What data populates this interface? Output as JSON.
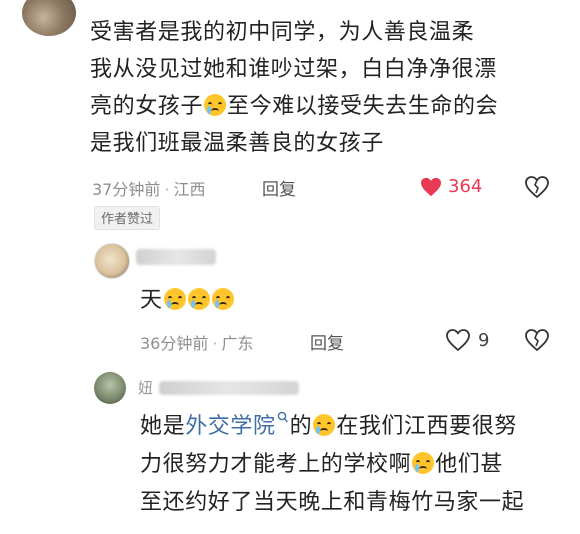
{
  "comment1": {
    "lines": [
      "受害者是我的初中同学，为人善良温柔",
      "我从没见过她和谁吵过架，白白净净很漂",
      "亮的女孩子",
      "至今难以接受失去生命的会",
      "是我们班最温柔善良的女孩子"
    ],
    "time": "37分钟前",
    "location": "江西",
    "reply_label": "回复",
    "likes": "364",
    "author_badge": "作者赞过"
  },
  "reply1": {
    "text": "天",
    "time": "36分钟前",
    "location": "广东",
    "reply_label": "回复",
    "likes": "9"
  },
  "comment2": {
    "name_prefix": "妞",
    "line1_a": "她是",
    "line1_link": "外交学院",
    "line1_b": "的",
    "line1_c": "在我们江西要很努",
    "line2_a": "力很努力才能考上的学校啊",
    "line2_b": "他们甚",
    "line3": "至还约好了当天晚上和青梅竹马家一起"
  },
  "colors": {
    "like_red": "#e83955",
    "link_blue": "#3f6fa6",
    "meta_gray": "#8f8f8f"
  },
  "icons": [
    "heart-filled-icon",
    "heart-outline-icon",
    "dislike-icon",
    "search-hint-icon",
    "crying-face-emoji"
  ]
}
